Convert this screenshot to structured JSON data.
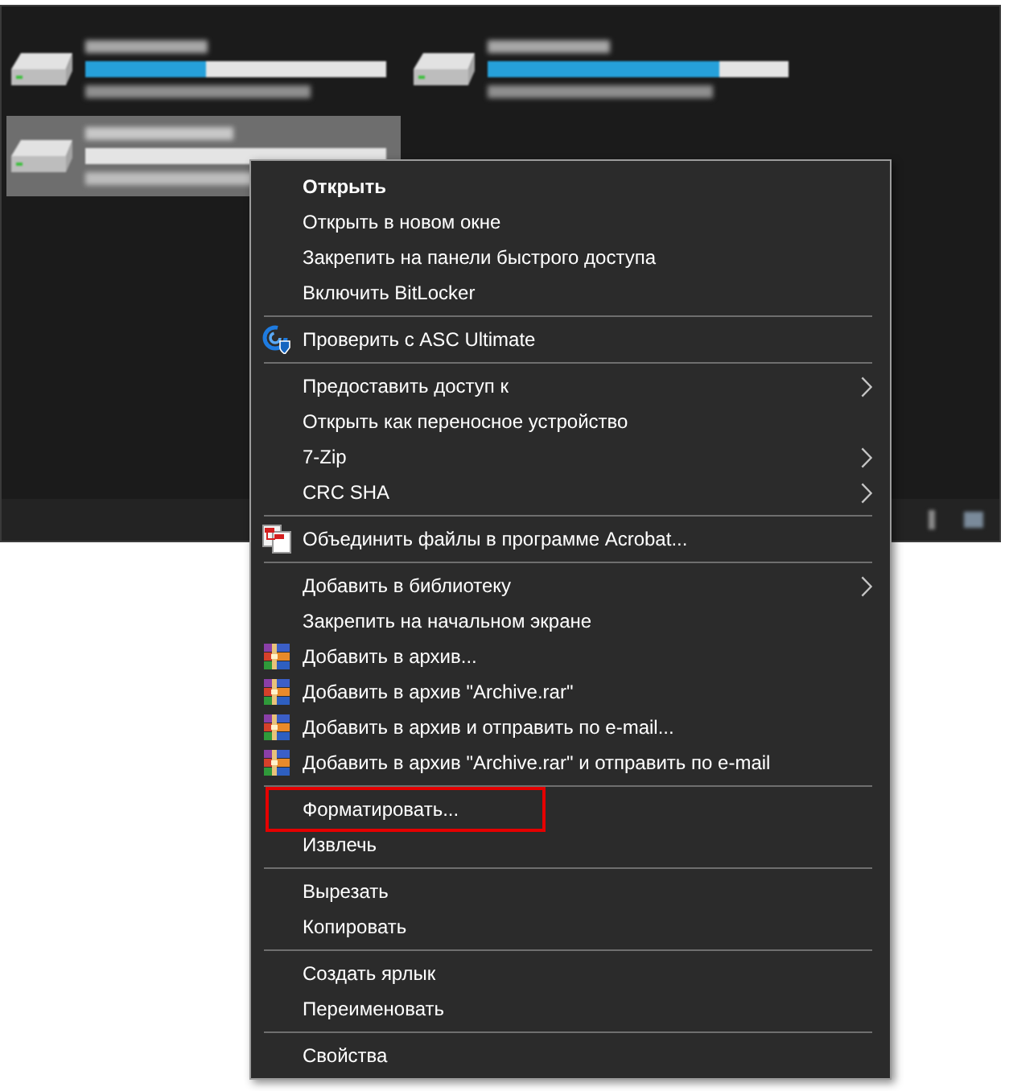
{
  "explorer": {
    "drives": [
      {
        "selected": false,
        "level": 0.4
      },
      {
        "selected": false,
        "level": 0.77
      },
      {
        "selected": true
      }
    ]
  },
  "context_menu": {
    "groups": [
      {
        "items": [
          {
            "label": "Открыть",
            "kind": "plain",
            "default": true,
            "submenu": false,
            "highlighted": false
          },
          {
            "label": "Открыть в новом окне",
            "kind": "plain",
            "default": false,
            "submenu": false,
            "highlighted": false
          },
          {
            "label": "Закрепить на панели быстрого доступа",
            "kind": "plain",
            "default": false,
            "submenu": false,
            "highlighted": false
          },
          {
            "label": "Включить BitLocker",
            "kind": "plain",
            "default": false,
            "submenu": false,
            "highlighted": false
          }
        ]
      },
      {
        "items": [
          {
            "label": "Проверить с ASC Ultimate",
            "kind": "antivirus",
            "default": false,
            "submenu": false,
            "highlighted": false
          }
        ]
      },
      {
        "items": [
          {
            "label": "Предоставить доступ к",
            "kind": "plain",
            "default": false,
            "submenu": true,
            "highlighted": false
          },
          {
            "label": "Открыть как переносное устройство",
            "kind": "plain",
            "default": false,
            "submenu": false,
            "highlighted": false
          },
          {
            "label": "7-Zip",
            "kind": "plain",
            "default": false,
            "submenu": true,
            "highlighted": false
          },
          {
            "label": "CRC SHA",
            "kind": "plain",
            "default": false,
            "submenu": true,
            "highlighted": false
          }
        ]
      },
      {
        "items": [
          {
            "label": "Объединить файлы в программе Acrobat...",
            "kind": "pdf-merge",
            "default": false,
            "submenu": false,
            "highlighted": false
          }
        ]
      },
      {
        "items": [
          {
            "label": "Добавить в библиотеку",
            "kind": "plain",
            "default": false,
            "submenu": true,
            "highlighted": false
          },
          {
            "label": "Закрепить на начальном экране",
            "kind": "plain",
            "default": false,
            "submenu": false,
            "highlighted": false
          },
          {
            "label": "Добавить в архив...",
            "kind": "archive",
            "default": false,
            "submenu": false,
            "highlighted": false
          },
          {
            "label": "Добавить в архив \"Archive.rar\"",
            "kind": "archive",
            "default": false,
            "submenu": false,
            "highlighted": false
          },
          {
            "label": "Добавить в архив и отправить по e-mail...",
            "kind": "archive",
            "default": false,
            "submenu": false,
            "highlighted": false
          },
          {
            "label": "Добавить в архив \"Archive.rar\" и отправить по e-mail",
            "kind": "archive",
            "default": false,
            "submenu": false,
            "highlighted": false
          }
        ]
      },
      {
        "items": [
          {
            "label": "Форматировать...",
            "kind": "plain",
            "default": false,
            "submenu": false,
            "highlighted": true
          },
          {
            "label": "Извлечь",
            "kind": "plain",
            "default": false,
            "submenu": false,
            "highlighted": false
          }
        ]
      },
      {
        "items": [
          {
            "label": "Вырезать",
            "kind": "plain",
            "default": false,
            "submenu": false,
            "highlighted": false
          },
          {
            "label": "Копировать",
            "kind": "plain",
            "default": false,
            "submenu": false,
            "highlighted": false
          }
        ]
      },
      {
        "items": [
          {
            "label": "Создать ярлык",
            "kind": "plain",
            "default": false,
            "submenu": false,
            "highlighted": false
          },
          {
            "label": "Переименовать",
            "kind": "plain",
            "default": false,
            "submenu": false,
            "highlighted": false
          }
        ]
      },
      {
        "items": [
          {
            "label": "Свойства",
            "kind": "plain",
            "default": false,
            "submenu": false,
            "highlighted": false
          }
        ]
      }
    ]
  }
}
